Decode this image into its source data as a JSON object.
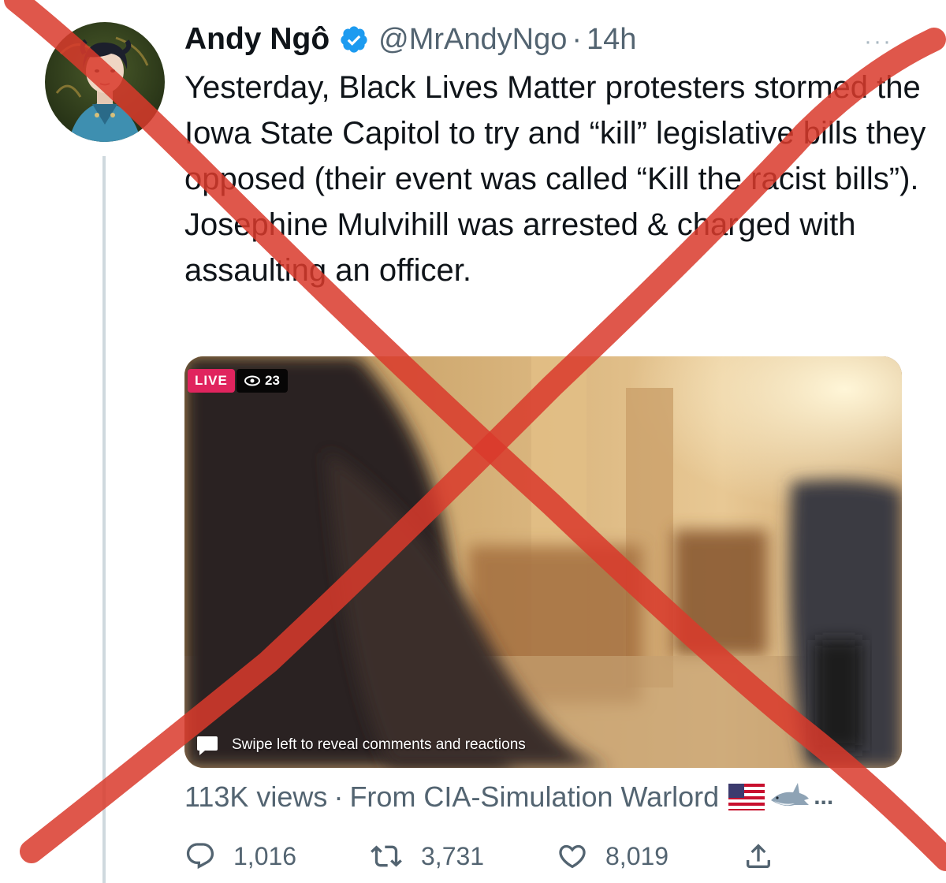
{
  "tweet": {
    "author": {
      "display_name": "Andy Ngô",
      "handle": "@MrAndyNgo",
      "verified": true,
      "avatar_icon": "avatar-illustration"
    },
    "separator": "·",
    "timestamp": "14h",
    "more_icon": "more-icon",
    "more_label": "···",
    "text": "Yesterday, Black Lives Matter protesters stormed the Iowa State Capitol to try and “kill” legislative bills they opposed (their event was called “Kill the racist bills”). Josephine Mulvihill was arrested & charged with assaulting an officer.",
    "media": {
      "type": "video",
      "live_label": "LIVE",
      "viewer_count": "23",
      "overlay_hint": "Swipe left to reveal comments and reactions"
    },
    "meta": {
      "views": "113K views",
      "dot": "·",
      "source": "From CIA-Simulation Warlord",
      "source_emojis": [
        "us-flag",
        "shark"
      ],
      "overflow": "..."
    },
    "actions": {
      "reply_count": "1,016",
      "retweet_count": "3,731",
      "like_count": "8,019",
      "reply_icon": "reply-icon",
      "retweet_icon": "retweet-icon",
      "like_icon": "heart-icon",
      "share_icon": "share-icon"
    }
  },
  "overlay": {
    "type": "red-x-mark",
    "color": "#d93a2b"
  },
  "colors": {
    "text_primary": "#0f1419",
    "text_secondary": "#536471",
    "verified_blue": "#1d9bf0",
    "live_red": "#e0245e"
  }
}
